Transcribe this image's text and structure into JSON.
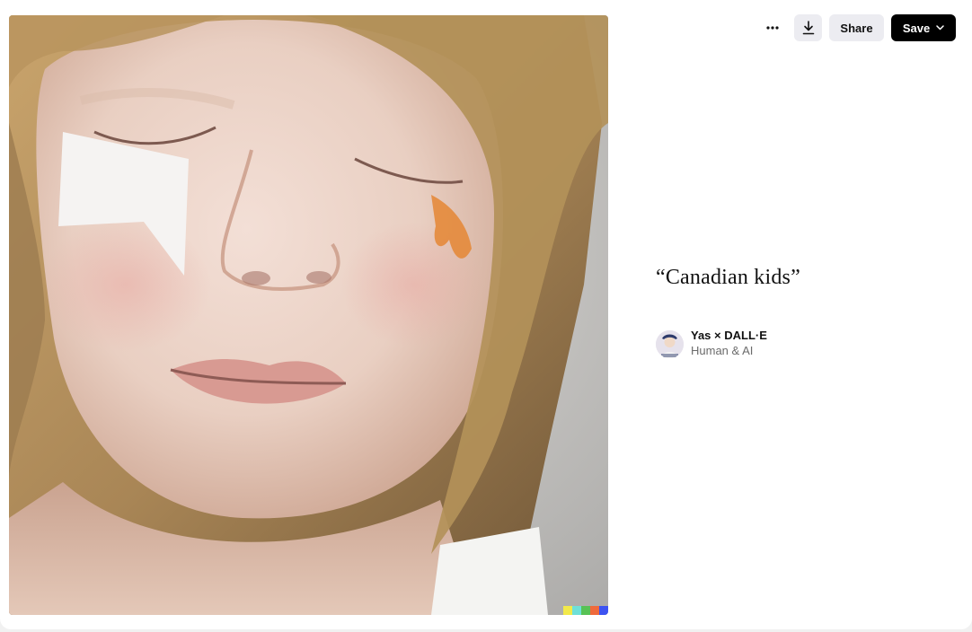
{
  "toolbar": {
    "more_icon": "ellipsis-icon",
    "download_icon": "download-icon",
    "share_label": "Share",
    "save_label": "Save",
    "save_chevron_icon": "chevron-down-icon"
  },
  "image": {
    "subject": "close-up portrait photo",
    "color_strip": [
      "#f2e94a",
      "#6fe0d8",
      "#58c255",
      "#ef6a3c",
      "#3d53f1"
    ]
  },
  "caption": "“Canadian kids”",
  "author": {
    "name": "Yas × DALL·E",
    "subtitle": "Human & AI"
  }
}
